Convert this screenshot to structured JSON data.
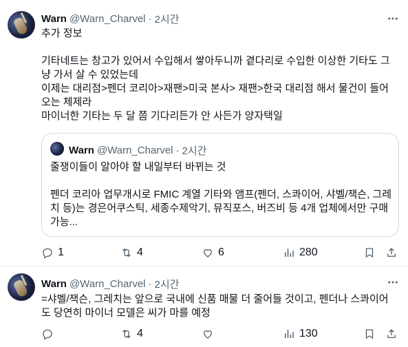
{
  "tweets": [
    {
      "name": "Warn",
      "handle": "@Warn_Charvel",
      "dot": "·",
      "time": "2시간",
      "lines": [
        "추가 정보",
        "",
        "기타네트는 창고가 있어서 수입해서 쌓아두니까 곁다리로 수입한 이상한 기타도 그",
        "냥 가서 살 수 있었는데",
        "이제는 대리점>펜더 코리아>재팬>미국 본사> 재팬>한국 대리점 해서 물건이 들어",
        "오는 체제라",
        "마이너한 기타는 두 달 쯤 기다리든가 안 사든가 양자택일"
      ],
      "quote": {
        "name": "Warn",
        "handle": "@Warn_Charvel",
        "dot": "·",
        "time": "2시간",
        "lines": [
          "줄쟁이들이 알아야 할 내일부터 바뀌는 것",
          "",
          "펜더 코리아 업무개시로 FMIC 계열 기타와 앰프(펜더, 스콰이어, 샤벨/잭슨, 그레",
          "치 등)는 경은어쿠스틱, 세종수제악기, 뮤직포스, 버즈비 등 4개 업체에서만 구매",
          "가능..."
        ]
      },
      "counts": {
        "replies": "1",
        "retweets": "4",
        "likes": "6",
        "views": "280"
      }
    },
    {
      "name": "Warn",
      "handle": "@Warn_Charvel",
      "dot": "·",
      "time": "2시간",
      "lines": [
        "=샤벨/잭슨, 그레치는 앞으로 국내에 신품 매물 더 줄어들 것이고, 펜더나 스콰이어",
        "도 당연히 마이너 모델은 씨가 마를 예정"
      ],
      "counts": {
        "replies": "",
        "retweets": "4",
        "likes": "",
        "views": "130"
      }
    }
  ],
  "icons": {
    "reply": "reply-icon",
    "retweet": "retweet-icon",
    "like": "heart-icon",
    "views": "views-icon",
    "bookmark": "bookmark-icon",
    "share": "share-icon",
    "more": "more-icon"
  },
  "colors": {
    "text": "#0f1419",
    "muted": "#536471",
    "border": "#cfd9de"
  }
}
